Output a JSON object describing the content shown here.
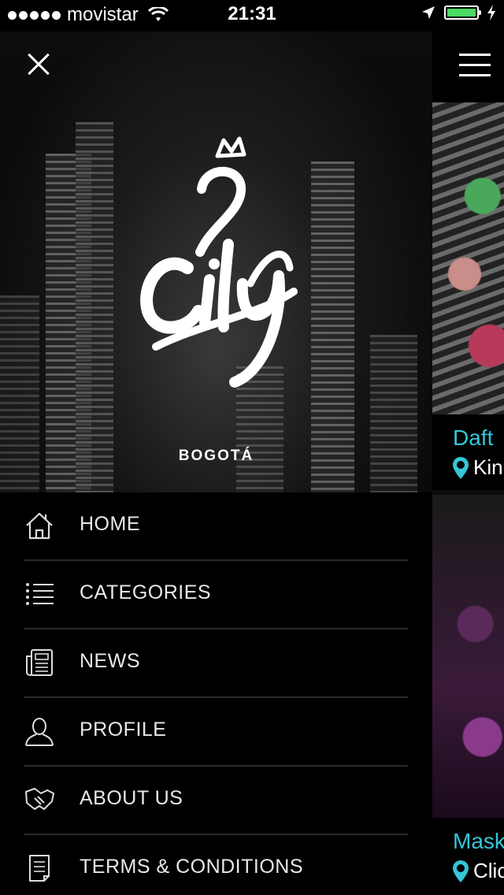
{
  "status_bar": {
    "carrier": "movistar",
    "time": "21:31",
    "battery_level": 1.0
  },
  "drawer": {
    "city": "BOGOTÁ",
    "menu": [
      {
        "label": "HOME",
        "icon": "house-icon"
      },
      {
        "label": "CATEGORIES",
        "icon": "list-icon"
      },
      {
        "label": "NEWS",
        "icon": "newspaper-icon"
      },
      {
        "label": "PROFILE",
        "icon": "user-icon"
      },
      {
        "label": "ABOUT US",
        "icon": "handshake-icon"
      },
      {
        "label": "TERMS & CONDITIONS",
        "icon": "document-icon"
      }
    ]
  },
  "content": {
    "cards": [
      {
        "title": "Daft",
        "location": "Kin"
      },
      {
        "title": "Mask",
        "location": "Clic"
      }
    ]
  },
  "colors": {
    "accent": "#35c6d8",
    "battery": "#4cd964",
    "background": "#000000"
  }
}
